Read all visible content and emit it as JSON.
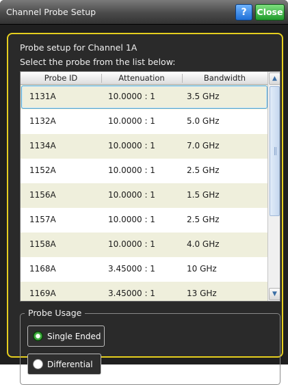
{
  "window": {
    "title": "Channel Probe Setup",
    "help_label": "?",
    "close_label": "Close"
  },
  "main": {
    "heading": "Probe setup for Channel 1A",
    "instruction": "Select the probe from the list below:"
  },
  "table": {
    "columns": [
      "Probe ID",
      "Attenuation",
      "Bandwidth"
    ],
    "selected_index": 0,
    "rows": [
      {
        "probe_id": "1131A",
        "attenuation": "10.0000 : 1",
        "bandwidth": "3.5 GHz"
      },
      {
        "probe_id": "1132A",
        "attenuation": "10.0000 : 1",
        "bandwidth": "5.0 GHz"
      },
      {
        "probe_id": "1134A",
        "attenuation": "10.0000 : 1",
        "bandwidth": "7.0 GHz"
      },
      {
        "probe_id": "1152A",
        "attenuation": "10.0000 : 1",
        "bandwidth": "2.5 GHz"
      },
      {
        "probe_id": "1156A",
        "attenuation": "10.0000 : 1",
        "bandwidth": "1.5 GHz"
      },
      {
        "probe_id": "1157A",
        "attenuation": "10.0000 : 1",
        "bandwidth": "2.5 GHz"
      },
      {
        "probe_id": "1158A",
        "attenuation": "10.0000 : 1",
        "bandwidth": "4.0 GHz"
      },
      {
        "probe_id": "1168A",
        "attenuation": "3.45000 : 1",
        "bandwidth": "10 GHz"
      },
      {
        "probe_id": "1169A",
        "attenuation": "3.45000 : 1",
        "bandwidth": "13 GHz"
      }
    ]
  },
  "probe_usage": {
    "label": "Probe Usage",
    "options": [
      "Single Ended",
      "Differential"
    ],
    "selected": "Single Ended"
  },
  "colors": {
    "accent_border": "#e6cf1e",
    "help_button": "#1f6fd6",
    "close_button": "#1f9a2b",
    "selection_outline": "#4ca3d4",
    "radio_selected": "#3fae3f"
  },
  "icons": {
    "help": "question-mark-icon",
    "scroll_up": "chevron-up-icon",
    "scroll_down": "chevron-down-icon",
    "radio_on": "radio-selected-icon",
    "radio_off": "radio-unselected-icon"
  }
}
